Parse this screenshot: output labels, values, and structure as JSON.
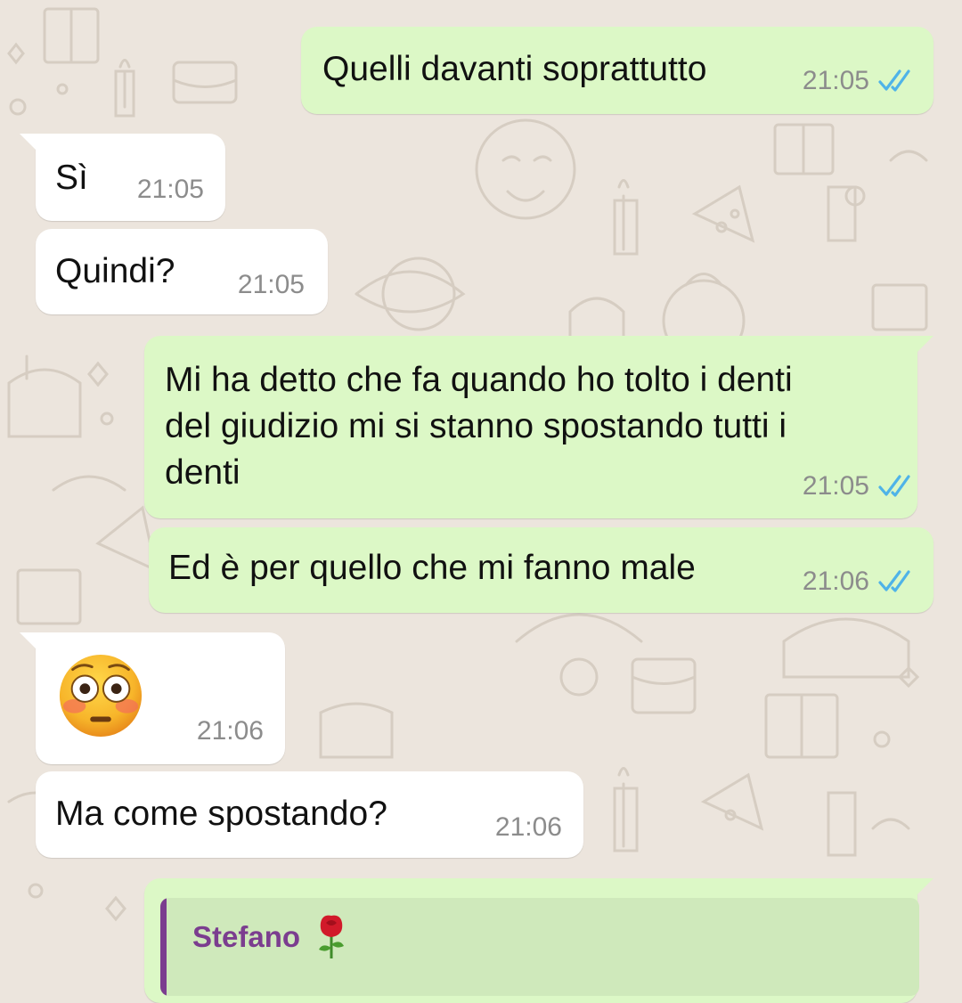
{
  "colors": {
    "wallpaper": "#ece5dd",
    "outgoing_bubble": "#dcf8c6",
    "incoming_bubble": "#ffffff",
    "read_ticks": "#4fb3e8",
    "timestamp": "#8c8c8c",
    "quote_author": "#7b3d8f"
  },
  "messages": [
    {
      "direction": "outgoing",
      "text": "Quelli davanti soprattutto",
      "time": "21:05",
      "status": "read-ticks-icon"
    },
    {
      "direction": "incoming",
      "text": "Sì",
      "time": "21:05"
    },
    {
      "direction": "incoming",
      "text": "Quindi?",
      "time": "21:05"
    },
    {
      "direction": "outgoing",
      "lines": [
        "Mi ha detto che fa quando ho tolto i denti",
        "del giudizio mi si stanno spostando tutti i",
        "denti"
      ],
      "time": "21:05",
      "status": "read-ticks-icon"
    },
    {
      "direction": "outgoing",
      "text": "Ed è per quello che mi fanno male",
      "time": "21:06",
      "status": "read-ticks-icon"
    },
    {
      "direction": "incoming",
      "emoji": "flushed-face-emoji",
      "time": "21:06"
    },
    {
      "direction": "incoming",
      "text": "Ma come spostando?",
      "time": "21:06"
    },
    {
      "direction": "outgoing",
      "quote": {
        "author": "Stefano",
        "author_emoji": "rose-emoji"
      }
    }
  ]
}
